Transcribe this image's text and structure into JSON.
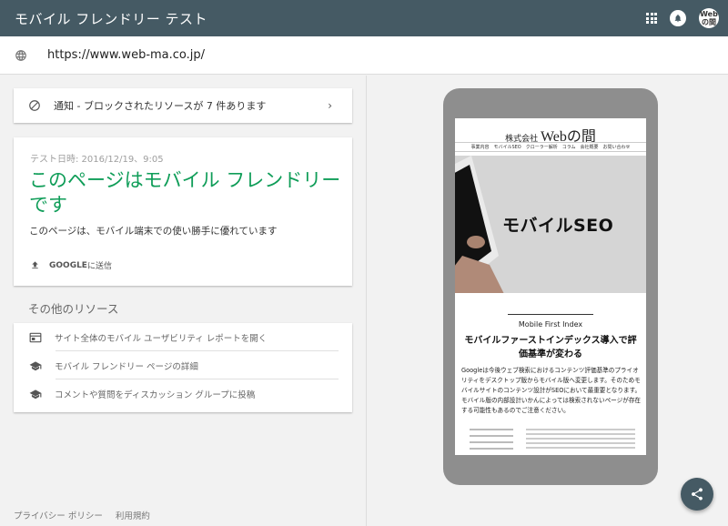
{
  "app": {
    "title": "モバイル フレンドリー テスト",
    "avatar_text_1": "Web",
    "avatar_text_2": "の間"
  },
  "url_bar": {
    "url": "https://www.web-ma.co.jp/"
  },
  "notice": {
    "text": "通知 - ブロックされたリソースが 7 件あります",
    "chevron": "›"
  },
  "result": {
    "date": "テスト日時: 2016/12/19、9:05",
    "headline": "このページはモバイル フレンドリーです",
    "description": "このページは、モバイル端末での使い勝手に優れています",
    "submit_brand": "GOOGLE",
    "submit_suffix": " に送信",
    "headline_color": "#0f9d58"
  },
  "resources": {
    "title": "その他のリソース",
    "items": [
      {
        "label": "サイト全体のモバイル ユーザビリティ レポートを開く",
        "icon": "report-icon"
      },
      {
        "label": "モバイル フレンドリー ページの詳細",
        "icon": "school-icon"
      },
      {
        "label": "コメントや質問をディスカッション グループに投稿",
        "icon": "school-icon"
      }
    ]
  },
  "footer": {
    "privacy": "プライバシー ポリシー",
    "terms": "利用規約"
  },
  "preview": {
    "logo_prefix": "株式会社",
    "logo_main": "Webの間",
    "nav": "事業内容　モバイルSEO　クローラー解析　コラム　会社概要　お問い合わせ",
    "hero_text": "モバイルSEO",
    "subtitle": "Mobile First Index",
    "heading": "モバイルファーストインデックス導入で評価基準が変わる",
    "body": "Googleは今後ウェブ検索におけるコンテンツ評価基準のプライオリティをデスクトップ版からモバイル版へ変更します。そのためモバイルサイトのコンテンツ設計がSEOにおいて最重要となります。モバイル版の内部設計いかんによっては検索されないページが存在する可能性もあるのでご注意ください。"
  },
  "colors": {
    "appbar": "#455a64",
    "fab": "#455a64"
  }
}
